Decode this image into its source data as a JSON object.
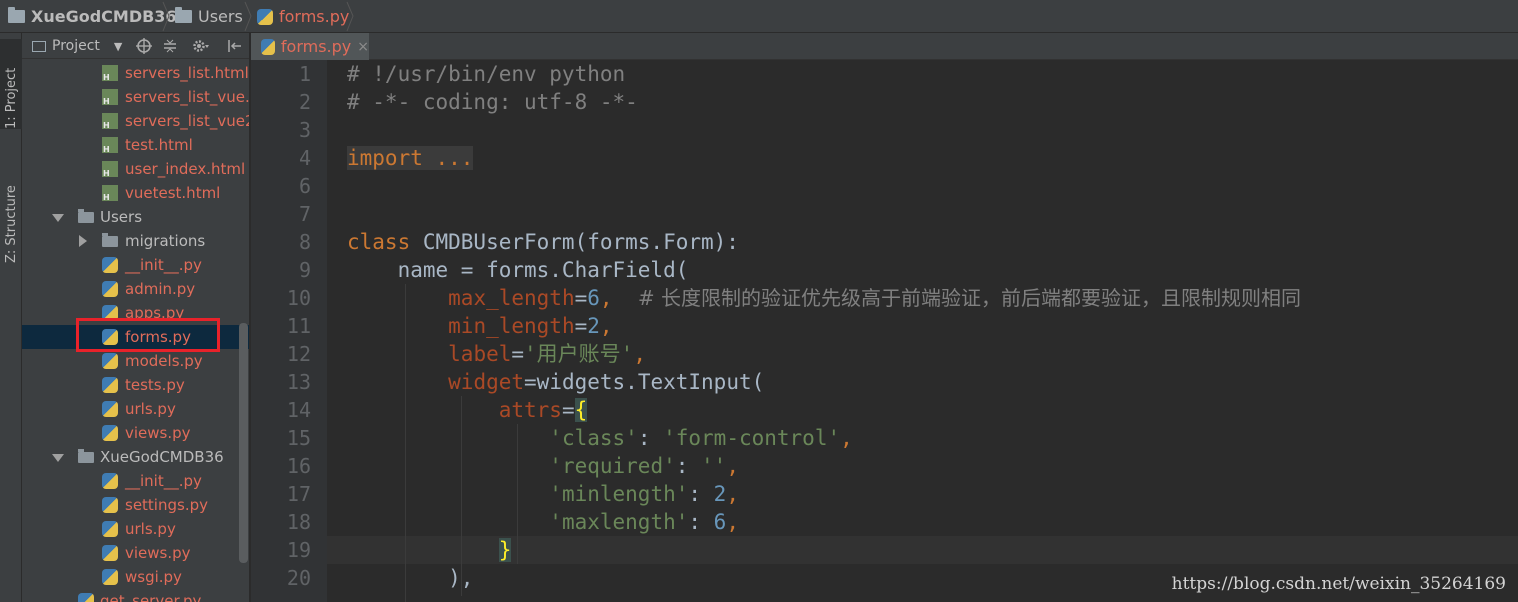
{
  "breadcrumb": {
    "items": [
      "XueGodCMDB36",
      "Users",
      "forms.py"
    ]
  },
  "tool_strip": {
    "project_tab": "1: Project",
    "structure_tab": "Z: Structure"
  },
  "project_panel": {
    "toolbar": {
      "title": "Project",
      "dropdown_arrow": "▼",
      "icons": [
        "target-icon",
        "collapse-icon",
        "gear-icon",
        "hide-icon"
      ]
    },
    "tree": [
      {
        "label": "servers_list.html",
        "type": "html",
        "depth": 3
      },
      {
        "label": "servers_list_vue.h",
        "type": "html",
        "depth": 3
      },
      {
        "label": "servers_list_vue2.",
        "type": "html",
        "depth": 3
      },
      {
        "label": "test.html",
        "type": "html",
        "depth": 3
      },
      {
        "label": "user_index.html",
        "type": "html",
        "depth": 3
      },
      {
        "label": "vuetest.html",
        "type": "html",
        "depth": 3
      },
      {
        "label": "Users",
        "type": "dir",
        "depth": 1,
        "expanded": true
      },
      {
        "label": "migrations",
        "type": "dir",
        "depth": 2,
        "expanded": false
      },
      {
        "label": "__init__.py",
        "type": "py",
        "depth": 3
      },
      {
        "label": "admin.py",
        "type": "py",
        "depth": 3
      },
      {
        "label": "apps.py",
        "type": "py",
        "depth": 3
      },
      {
        "label": "forms.py",
        "type": "py",
        "depth": 3,
        "selected": true
      },
      {
        "label": "models.py",
        "type": "py",
        "depth": 3
      },
      {
        "label": "tests.py",
        "type": "py",
        "depth": 3
      },
      {
        "label": "urls.py",
        "type": "py",
        "depth": 3
      },
      {
        "label": "views.py",
        "type": "py",
        "depth": 3
      },
      {
        "label": "XueGodCMDB36",
        "type": "dir",
        "depth": 1,
        "expanded": true
      },
      {
        "label": "__init__.py",
        "type": "py",
        "depth": 3
      },
      {
        "label": "settings.py",
        "type": "py",
        "depth": 3
      },
      {
        "label": "urls.py",
        "type": "py",
        "depth": 3
      },
      {
        "label": "views.py",
        "type": "py",
        "depth": 3
      },
      {
        "label": "wsgi.py",
        "type": "py",
        "depth": 3
      },
      {
        "label": "get_server.py",
        "type": "py",
        "depth": 2
      }
    ]
  },
  "editor": {
    "tab": {
      "label": "forms.py",
      "close": "×"
    },
    "line_numbers": [
      "1",
      "2",
      "3",
      "4",
      "6",
      "7",
      "8",
      "9",
      "10",
      "11",
      "12",
      "13",
      "14",
      "15",
      "16",
      "17",
      "18",
      "19",
      "20"
    ],
    "code": {
      "l1": "# !/usr/bin/env python",
      "l2": "# -*- coding: utf-8 -*-",
      "l4": "import ...",
      "l8_kw": "class",
      "l8_rest": " CMDBUserForm(forms.Form):",
      "l9": "    name = forms.CharField(",
      "l10_arg": "max_length",
      "l10_val": "6",
      "l10_comment": "# 长度限制的验证优先级高于前端验证，前后端都要验证，且限制规则相同",
      "l11_arg": "min_length",
      "l11_val": "2",
      "l12_arg": "label",
      "l12_val": "'用户账号'",
      "l13_arg": "widget",
      "l13_rest": "widgets.TextInput(",
      "l14_arg": "attrs",
      "l15_key": "'class'",
      "l15_val": "'form-control'",
      "l16_key": "'required'",
      "l16_val": "''",
      "l17_key": "'minlength'",
      "l17_val": "2",
      "l18_key": "'maxlength'",
      "l18_val": "6",
      "l19": "}",
      "l20": "),"
    }
  },
  "watermark": "https://blog.csdn.net/weixin_35264169"
}
